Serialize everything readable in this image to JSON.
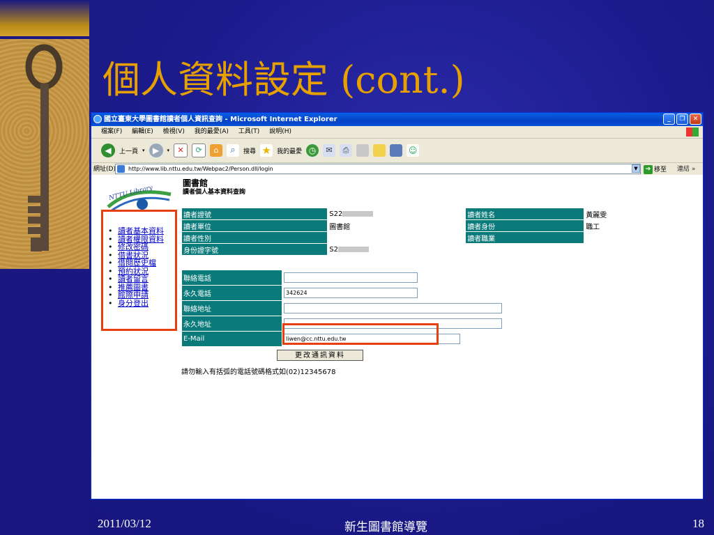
{
  "slide": {
    "title": "個人資料設定 (cont.)",
    "footer_date": "2011/03/12",
    "footer_center": "新生圖書館導覽",
    "footer_page": "18"
  },
  "window": {
    "title": "國立臺東大學圖書館讀者個人資訊查詢 - Microsoft Internet Explorer",
    "menu": [
      "檔案(F)",
      "編輯(E)",
      "檢視(V)",
      "我的最愛(A)",
      "工具(T)",
      "說明(H)"
    ],
    "toolbar": {
      "back": "上一頁",
      "search": "搜尋",
      "favorites": "我的最愛"
    },
    "address_label": "網址(D)",
    "address_value": "http://www.lib.nttu.edu.tw/Webpac2/Person.dll/login",
    "go_label": "移至",
    "links_label": "連結"
  },
  "page": {
    "logo_text": "NTTU Library",
    "heading": "圖書館",
    "subheading": "讀者個人基本資料查詢",
    "nav": [
      "讀者基本資料",
      "讀者權限資料",
      "修改密碼",
      "借書狀況",
      "借閱歷史檔",
      "預約狀況",
      "讀者留言",
      "推薦圖書",
      "館際申請",
      "身分登出"
    ],
    "info": {
      "card_no_label": "讀者證號",
      "card_no_value": "S22",
      "name_label": "讀者姓名",
      "name_value": "黃麗雯",
      "unit_label": "讀者單位",
      "unit_value": "圖書館",
      "identity_label": "讀者身份",
      "identity_value": "職工",
      "gender_label": "讀者性別",
      "occupation_label": "讀者職業",
      "id_no_label": "身份證字號",
      "id_no_value": "S2"
    },
    "contact": {
      "phone_label": "聯絡電話",
      "phone_value": "",
      "perm_phone_label": "永久電話",
      "perm_phone_value": "342624",
      "address_label": "聯絡地址",
      "address_value": "",
      "perm_address_label": "永久地址",
      "perm_address_value": "",
      "email_label": "E-Mail",
      "email_value": "liwen@cc.nttu.edu.tw"
    },
    "update_button": "更改通訊資料",
    "note": "請勿輸入有括弧的電話號碼格式如(02)12345678"
  },
  "colors": {
    "slide_bg": "#1c1b8c",
    "title": "#e6a000",
    "table_label_bg": "#0b7a7a",
    "highlight_box": "#e64010",
    "link": "#0000cc"
  }
}
